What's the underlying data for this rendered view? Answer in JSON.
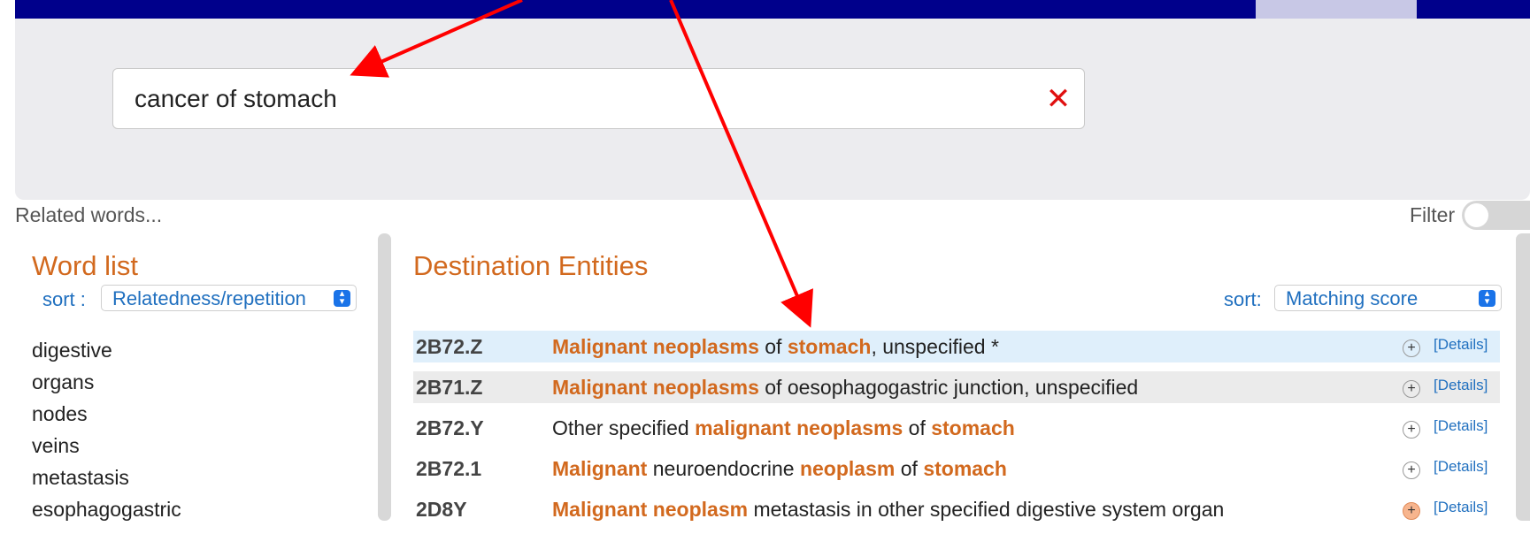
{
  "search": {
    "query": "cancer of stomach"
  },
  "related_label": "Related words...",
  "filter_label": "Filter",
  "word_list": {
    "title": "Word list",
    "sort_label": "sort :",
    "sort_value": "Relatedness/repetition",
    "words": [
      "digestive",
      "organs",
      "nodes",
      "veins",
      "metastasis",
      "esophagogastric"
    ]
  },
  "destination": {
    "title": "Destination Entities",
    "sort_label": "sort:",
    "sort_value": "Matching score",
    "details_label": "[Details]",
    "rows": [
      {
        "code": "2B72.Z",
        "parts": [
          [
            "Malignant neoplasms",
            true
          ],
          [
            " of ",
            false
          ],
          [
            "stomach",
            true
          ],
          [
            ", unspecified *",
            false
          ]
        ]
      },
      {
        "code": "2B71.Z",
        "parts": [
          [
            "Malignant neoplasms",
            true
          ],
          [
            " of oesophagogastric junction, unspecified",
            false
          ]
        ]
      },
      {
        "code": "2B72.Y",
        "parts": [
          [
            "Other specified ",
            false
          ],
          [
            "malignant neoplasms",
            true
          ],
          [
            " of ",
            false
          ],
          [
            "stomach",
            true
          ]
        ]
      },
      {
        "code": "2B72.1",
        "parts": [
          [
            "Malignant",
            true
          ],
          [
            " neuroendocrine ",
            false
          ],
          [
            "neoplasm",
            true
          ],
          [
            " of ",
            false
          ],
          [
            "stomach",
            true
          ]
        ]
      },
      {
        "code": "2D8Y",
        "parts": [
          [
            "Malignant neoplasm",
            true
          ],
          [
            " metastasis in other specified digestive system organ",
            false
          ]
        ]
      }
    ]
  },
  "colors": {
    "accent": "#d2691e",
    "link": "#1f6fbf",
    "topbar": "#00008b",
    "annotation": "#ff0000"
  },
  "icons": {
    "clear": "close-icon",
    "expand": "plus-circle-icon",
    "sort": "chevron-updown-icon"
  }
}
